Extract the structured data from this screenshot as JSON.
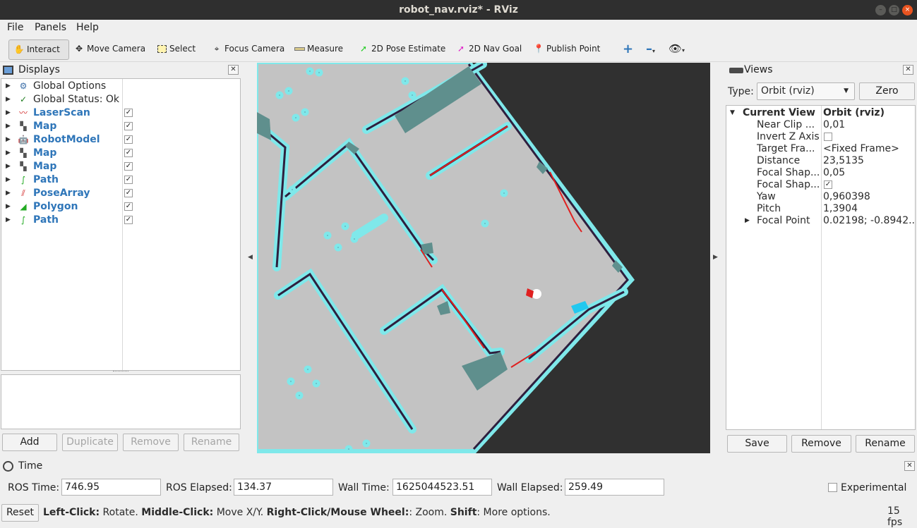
{
  "window": {
    "title": "robot_nav.rviz* - RViz"
  },
  "menu": {
    "file": "File",
    "panels": "Panels",
    "help": "Help"
  },
  "toolbar": {
    "interact": "Interact",
    "move_camera": "Move Camera",
    "select": "Select",
    "focus_camera": "Focus Camera",
    "measure": "Measure",
    "pose_estimate": "2D Pose Estimate",
    "nav_goal": "2D Nav Goal",
    "publish_point": "Publish Point"
  },
  "displays": {
    "title": "Displays",
    "items": [
      {
        "label": "Global Options",
        "icon": "gear-icon",
        "checkable": false
      },
      {
        "label": "Global Status: Ok",
        "icon": "check-icon",
        "checkable": false
      },
      {
        "label": "LaserScan",
        "icon": "laserscan-icon",
        "checkable": true,
        "checked": true
      },
      {
        "label": "Map",
        "icon": "map-icon",
        "checkable": true,
        "checked": true
      },
      {
        "label": "RobotModel",
        "icon": "robotmodel-icon",
        "checkable": true,
        "checked": true
      },
      {
        "label": "Map",
        "icon": "map-icon",
        "checkable": true,
        "checked": true
      },
      {
        "label": "Map",
        "icon": "map-icon",
        "checkable": true,
        "checked": true
      },
      {
        "label": "Path",
        "icon": "path-icon",
        "checkable": true,
        "checked": true
      },
      {
        "label": "PoseArray",
        "icon": "posearray-icon",
        "checkable": true,
        "checked": true
      },
      {
        "label": "Polygon",
        "icon": "polygon-icon",
        "checkable": true,
        "checked": true
      },
      {
        "label": "Path",
        "icon": "path-icon",
        "checkable": true,
        "checked": true
      }
    ],
    "buttons": {
      "add": "Add",
      "duplicate": "Duplicate",
      "remove": "Remove",
      "rename": "Rename"
    }
  },
  "views": {
    "title": "Views",
    "type_label": "Type:",
    "type_value": "Orbit (rviz)",
    "zero": "Zero",
    "current_view": {
      "label": "Current View",
      "value": "Orbit (rviz)"
    },
    "props": [
      {
        "name": "Near Clip ...",
        "value": "0,01"
      },
      {
        "name": "Invert Z Axis",
        "value": "",
        "checkbox": true,
        "checked": false
      },
      {
        "name": "Target Fra...",
        "value": "<Fixed Frame>"
      },
      {
        "name": "Distance",
        "value": "23,5135"
      },
      {
        "name": "Focal Shap...",
        "value": "0,05"
      },
      {
        "name": "Focal Shap...",
        "value": "",
        "checkbox": true,
        "checked": true
      },
      {
        "name": "Yaw",
        "value": "0,960398"
      },
      {
        "name": "Pitch",
        "value": "1,3904"
      },
      {
        "name": "Focal Point",
        "value": "0.02198; -0.8942..."
      }
    ],
    "buttons": {
      "save": "Save",
      "remove": "Remove",
      "rename": "Rename"
    }
  },
  "time": {
    "title": "Time",
    "ros_time_label": "ROS Time:",
    "ros_time": "746.95",
    "ros_elapsed_label": "ROS Elapsed:",
    "ros_elapsed": "134.37",
    "wall_time_label": "Wall Time:",
    "wall_time": "1625044523.51",
    "wall_elapsed_label": "Wall Elapsed:",
    "wall_elapsed": "259.49",
    "experimental": "Experimental"
  },
  "status": {
    "reset": "Reset",
    "left_click": "Left-Click:",
    "left_click_desc": " Rotate. ",
    "middle_click": "Middle-Click:",
    "middle_click_desc": " Move X/Y. ",
    "right_click": "Right-Click/Mouse Wheel:",
    "right_click_desc": ": Zoom. ",
    "shift": "Shift",
    "shift_desc": ": More options.",
    "fps": "15 fps"
  },
  "colors": {
    "accent_blue": "#2f76b9",
    "map_free": "#c3c3c3",
    "map_inflation": "#7fe8ea",
    "map_unknown": "#303030",
    "laser": "#e02020"
  }
}
